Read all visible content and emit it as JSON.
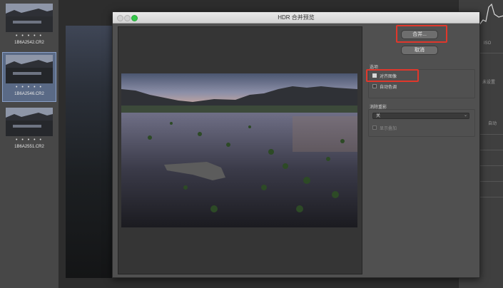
{
  "filmstrip": {
    "items": [
      {
        "name": "1B6A2542.CR2",
        "stars": "• • • • •",
        "selected": false
      },
      {
        "name": "1B6A2546.CR2",
        "stars": "• • • • •",
        "selected": true
      },
      {
        "name": "1B6A2551.CR2",
        "stars": "• • • • •",
        "selected": false
      }
    ]
  },
  "dialog": {
    "title": "HDR 合并预览",
    "merge_button": "合并...",
    "cancel_button": "取消",
    "options": {
      "heading": "选项",
      "align_images": {
        "label": "对齐图像",
        "checked": true
      },
      "auto_tone": {
        "label": "自动色调",
        "checked": false
      }
    },
    "deghost": {
      "heading": "消除重影",
      "selected": "关",
      "show_overlay": {
        "label": "显示叠加",
        "checked": false
      }
    }
  },
  "right_panel": {
    "labels": [
      "ISO",
      "未设置",
      "自动"
    ]
  },
  "colors": {
    "highlight_box": "#e0372b",
    "selection": "#5a6a86"
  }
}
